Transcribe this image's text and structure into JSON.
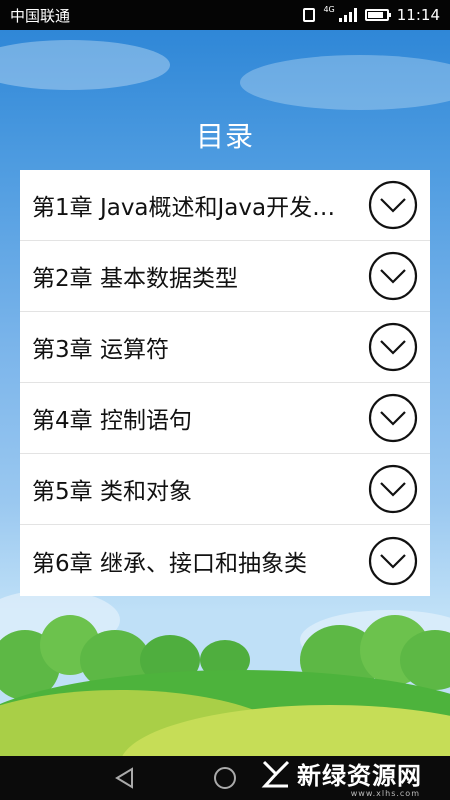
{
  "status_bar": {
    "carrier": "中国联通",
    "network": "4G",
    "time": "11:14",
    "battery_level": 0.85
  },
  "page": {
    "title": "目录"
  },
  "chapters": [
    {
      "label": "第1章 Java概述和Java开发…",
      "icon": "chevron-down-circle-icon"
    },
    {
      "label": "第2章 基本数据类型",
      "icon": "chevron-down-circle-icon"
    },
    {
      "label": "第3章 运算符",
      "icon": "chevron-down-circle-icon"
    },
    {
      "label": "第4章 控制语句",
      "icon": "chevron-down-circle-icon"
    },
    {
      "label": "第5章 类和对象",
      "icon": "chevron-down-circle-icon"
    },
    {
      "label": "第6章 继承、接口和抽象类",
      "icon": "chevron-down-circle-icon"
    }
  ],
  "nav_bar": {
    "buttons": [
      "back-icon",
      "home-icon"
    ]
  },
  "watermark": {
    "text": "新绿资源网",
    "subtext": "www.xlhs.com"
  },
  "colors": {
    "status_bar": "#050505",
    "sky_top": "#2f87d7",
    "list_background": "#ffffff",
    "grass": "#4db33c"
  }
}
